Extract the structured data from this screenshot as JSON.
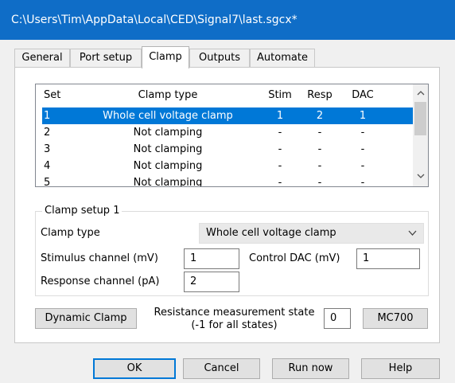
{
  "window": {
    "title": "C:\\Users\\Tim\\AppData\\Local\\CED\\Signal7\\last.sgcx*"
  },
  "tabs": [
    {
      "label": "General"
    },
    {
      "label": "Port setup"
    },
    {
      "label": "Clamp"
    },
    {
      "label": "Outputs"
    },
    {
      "label": "Automate"
    }
  ],
  "active_tab": "Clamp",
  "grid": {
    "headers": [
      "Set",
      "Clamp type",
      "Stim",
      "Resp",
      "DAC"
    ],
    "rows": [
      {
        "set": "1",
        "type": "Whole cell voltage clamp",
        "stim": "1",
        "resp": "2",
        "dac": "1"
      },
      {
        "set": "2",
        "type": "Not clamping",
        "stim": "-",
        "resp": "-",
        "dac": "-"
      },
      {
        "set": "3",
        "type": "Not clamping",
        "stim": "-",
        "resp": "-",
        "dac": "-"
      },
      {
        "set": "4",
        "type": "Not clamping",
        "stim": "-",
        "resp": "-",
        "dac": "-"
      },
      {
        "set": "5",
        "type": "Not clamping",
        "stim": "-",
        "resp": "-",
        "dac": "-"
      }
    ],
    "selected_row": 1,
    "scroll_up_icon": "chevron-up-icon",
    "scroll_down_icon": "chevron-down-icon"
  },
  "clamp_setup": {
    "title": "Clamp setup 1",
    "clamp_type_label": "Clamp type",
    "clamp_type_value": "Whole cell voltage clamp",
    "stimulus_label": "Stimulus channel (mV)",
    "stimulus_value": "1",
    "control_dac_label": "Control DAC (mV)",
    "control_dac_value": "1",
    "response_label": "Response channel (pA)",
    "response_value": "2"
  },
  "dynamic_clamp_label": "Dynamic Clamp",
  "resistance": {
    "label_line1": "Resistance measurement state",
    "label_line2": "(-1 for all states)",
    "value": "0"
  },
  "mc700_label": "MC700",
  "footer": {
    "ok": "OK",
    "cancel": "Cancel",
    "run_now": "Run now",
    "help": "Help"
  },
  "colors": {
    "title_bar": "#0f6dc7",
    "selection": "#0078d7",
    "dialog_bg": "#f0f0f0"
  }
}
